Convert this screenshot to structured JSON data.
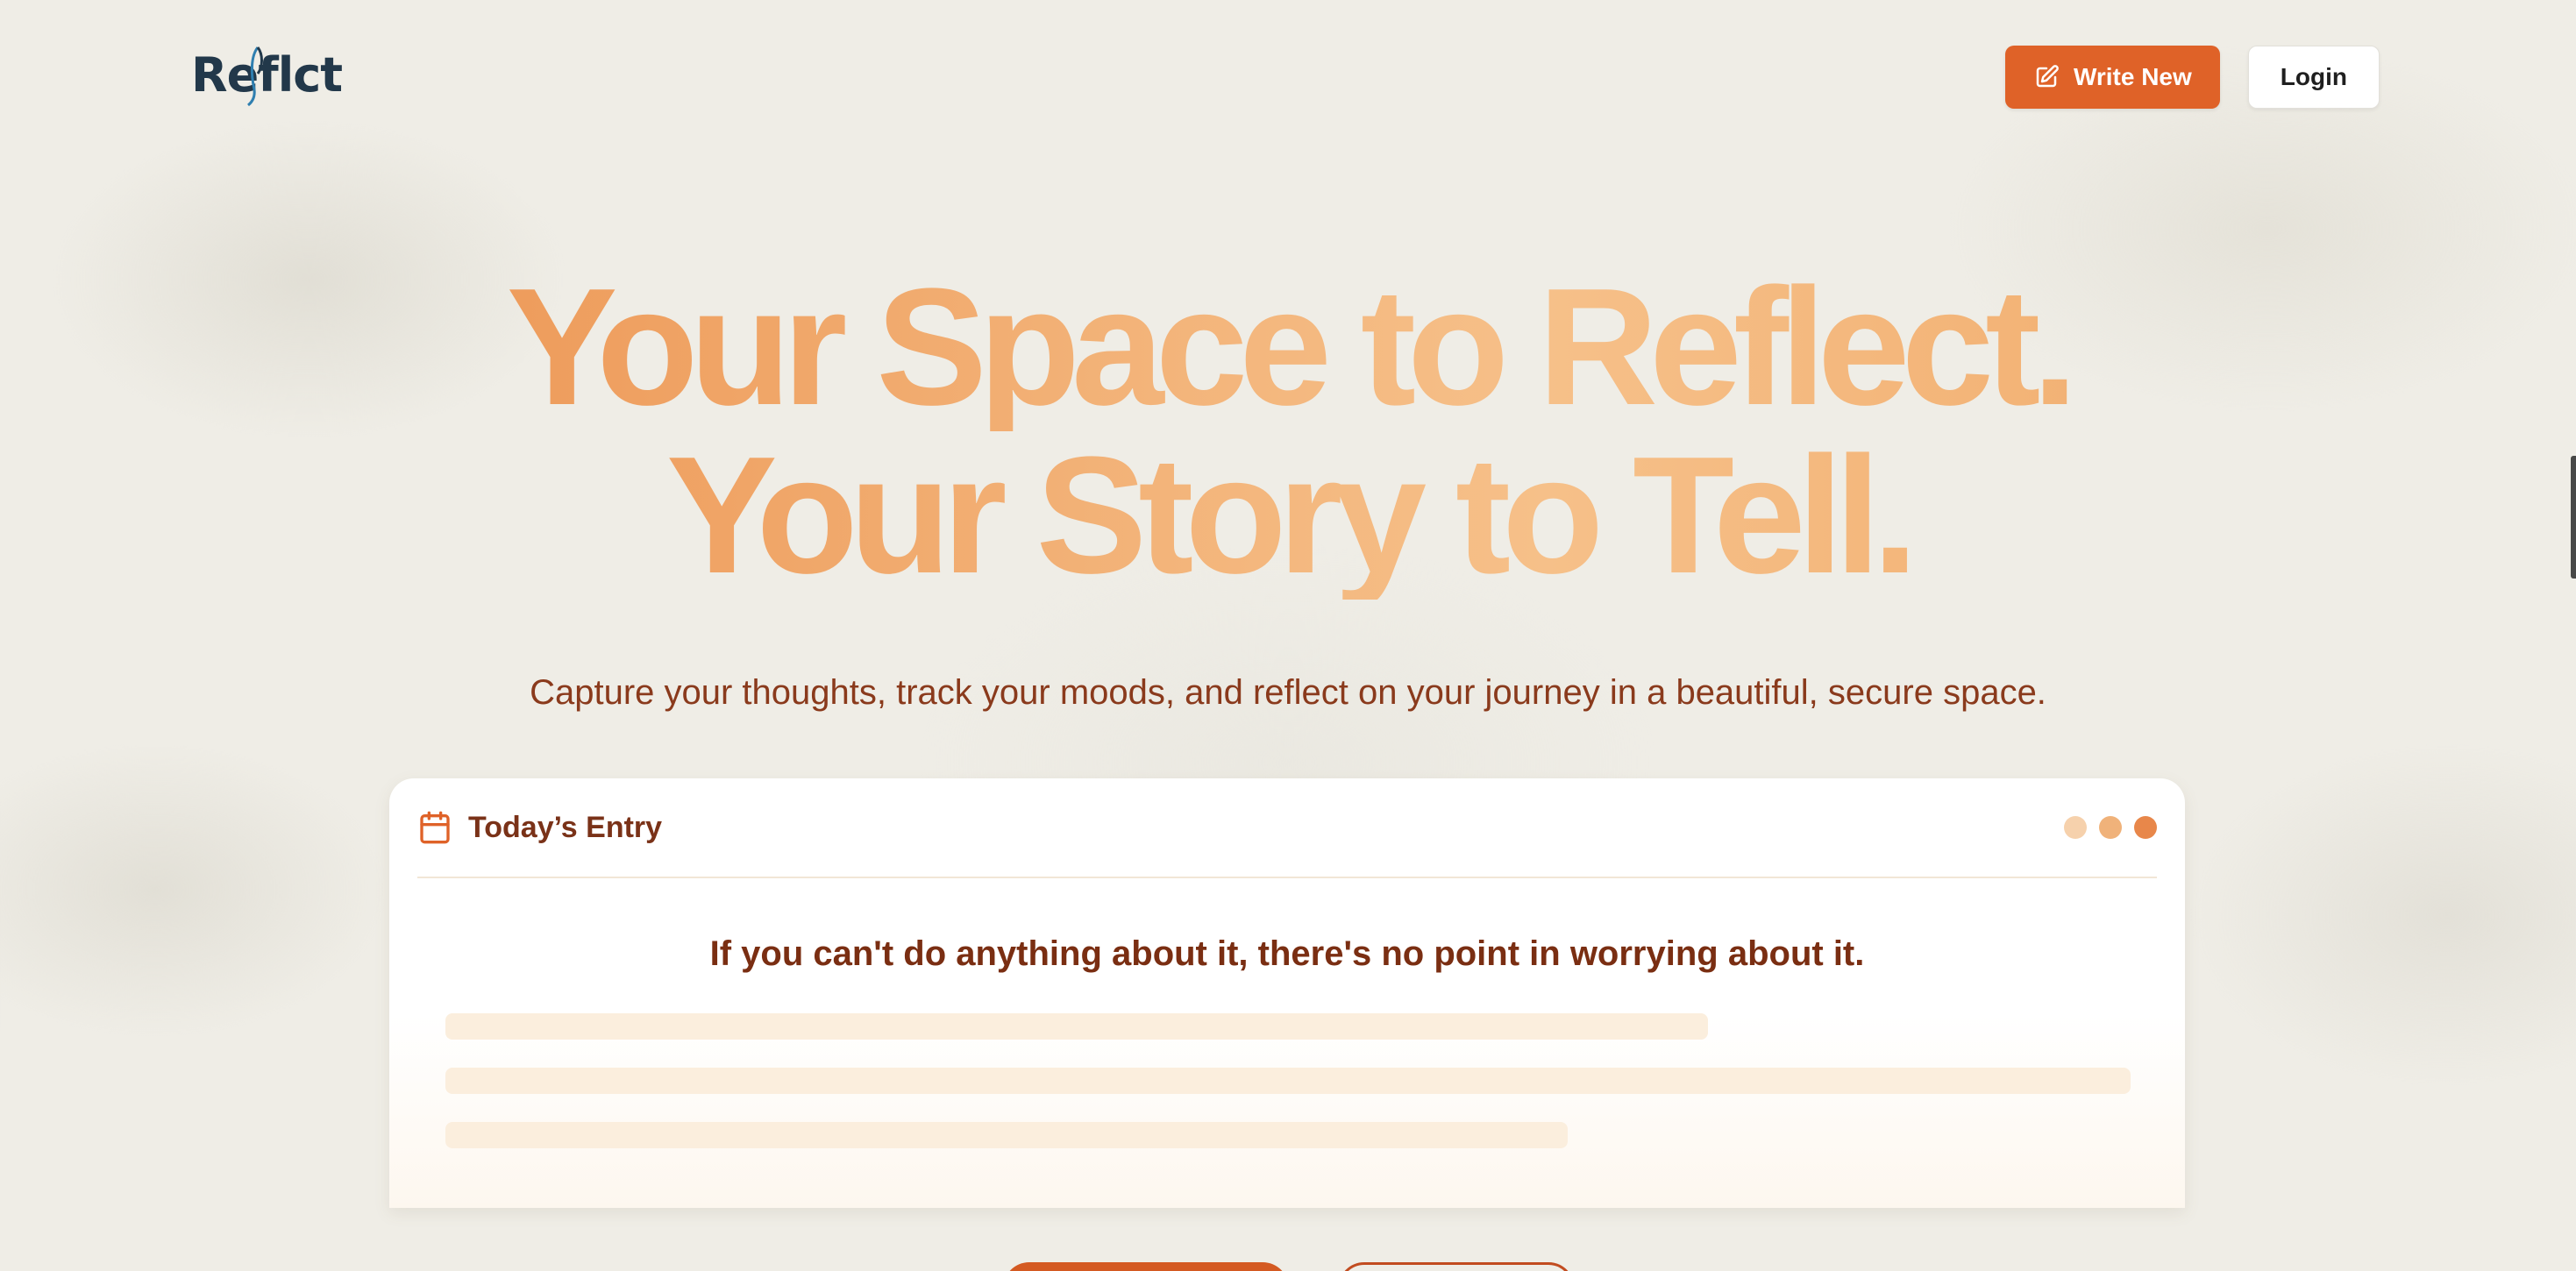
{
  "header": {
    "logo_text_before": "Re",
    "logo_text_f": "f",
    "logo_text_after": "lct",
    "write_new_label": "Write New",
    "write_new_icon": "pencil-square-icon",
    "login_label": "Login"
  },
  "hero": {
    "title_line1": "Your Space to Reflect.",
    "title_line2": "Your Story to Tell.",
    "subtitle": "Capture your thoughts, track your moods, and reflect on your journey in a beautiful, secure space."
  },
  "entry_card": {
    "icon": "calendar-icon",
    "title": "Today’s Entry",
    "quote": "If you can't do anything about it, there's no point in worrying about it."
  },
  "colors": {
    "accent": "#df6228",
    "heading_gradient_start": "#ea8a45",
    "heading_gradient_end": "#f6c089",
    "text_brown": "#7a2e12",
    "logo_navy": "#22384a",
    "background": "#efede6"
  }
}
